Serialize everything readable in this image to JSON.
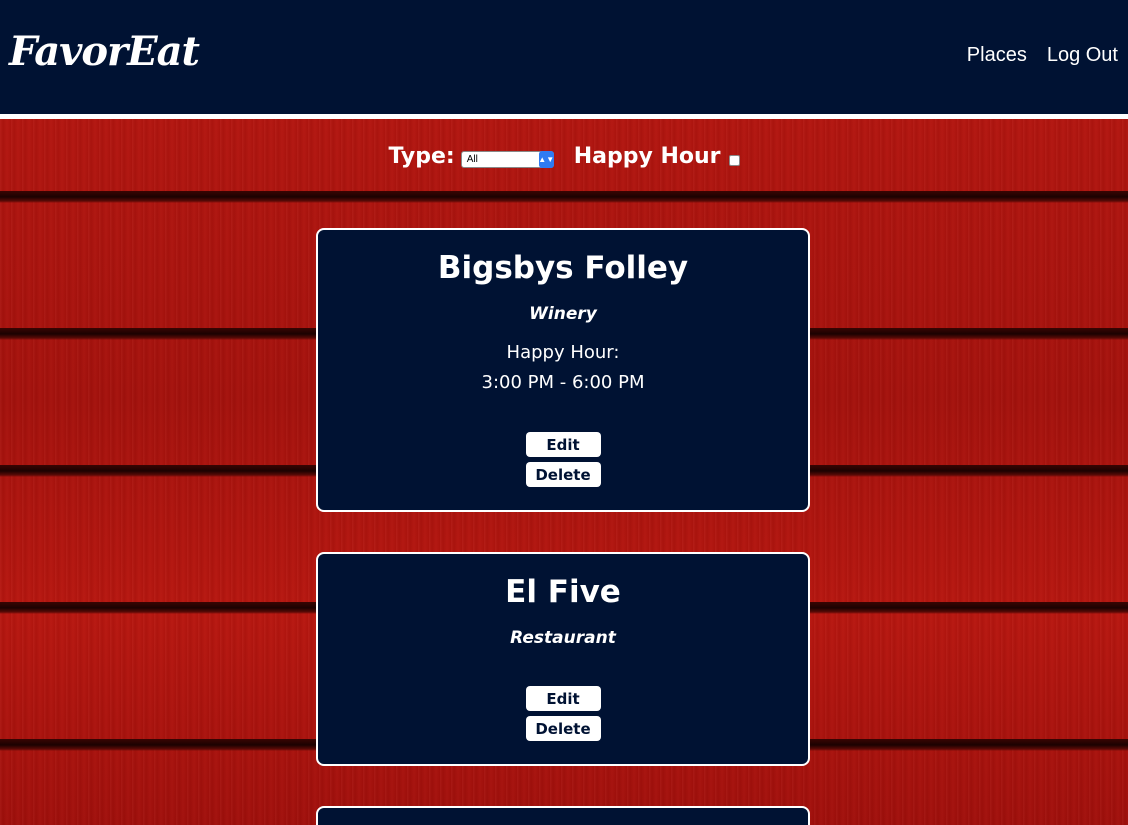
{
  "header": {
    "logo": "FavorEat",
    "nav": [
      "Places",
      "Log Out"
    ]
  },
  "filters": {
    "type_label": "Type:",
    "type_selected": "All",
    "happy_hour_label": "Happy Hour",
    "happy_hour_checked": false
  },
  "places": [
    {
      "name": "Bigsbys Folley",
      "type": "Winery",
      "happy_hour_label": "Happy Hour:",
      "happy_hour_time": "3:00 PM - 6:00 PM",
      "edit_label": "Edit",
      "delete_label": "Delete"
    },
    {
      "name": "El Five",
      "type": "Restaurant",
      "edit_label": "Edit",
      "delete_label": "Delete"
    }
  ]
}
